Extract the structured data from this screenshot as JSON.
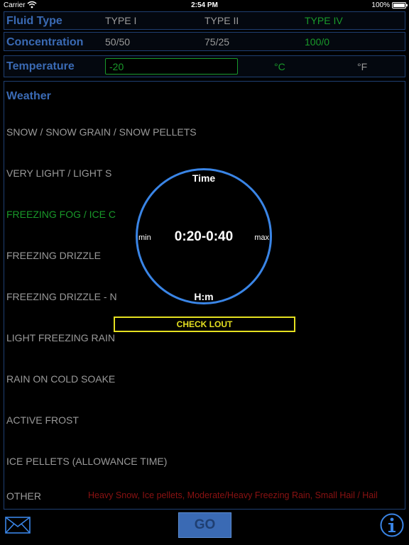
{
  "status_bar": {
    "carrier": "Carrier",
    "time": "2:54 PM",
    "battery": "100%",
    "battery_level": 1.0
  },
  "fluid_type": {
    "label": "Fluid Type",
    "options": [
      "TYPE I",
      "TYPE II",
      "TYPE IV"
    ],
    "selected": "TYPE IV"
  },
  "concentration": {
    "label": "Concentration",
    "options": [
      "50/50",
      "75/25",
      "100/0"
    ],
    "selected": "100/0"
  },
  "temperature": {
    "label": "Temperature",
    "value": "-20",
    "units": [
      "°C",
      "°F"
    ],
    "selected_unit": "°C"
  },
  "weather": {
    "label": "Weather",
    "items": [
      "SNOW / SNOW GRAIN / SNOW PELLETS",
      "VERY LIGHT / LIGHT S",
      "FREEZING FOG / ICE C",
      "FREEZING DRIZZLE",
      "FREEZING DRIZZLE - N",
      "LIGHT FREEZING RAIN",
      "RAIN ON COLD SOAKE",
      "ACTIVE FROST",
      "ICE PELLETS (ALLOWANCE TIME)",
      "OTHER"
    ],
    "selected": "FREEZING FOG / ICE C",
    "other_note": "Heavy Snow, Ice pellets, Moderate/Heavy Freezing Rain, Small Hail / Hail"
  },
  "result": {
    "title": "Time",
    "value": "0:20-0:40",
    "min_label": "min",
    "max_label": "max",
    "unit": "H:m"
  },
  "check_button": "CHECK LOUT",
  "go_button": "GO",
  "icons": {
    "mail": "mail-icon",
    "info": "info-icon",
    "wifi": "wifi-icon"
  },
  "colors": {
    "accent_blue": "#3a6ab4",
    "selected_green": "#19992a",
    "circle_blue": "#3a85e6",
    "warning_yellow": "#e5e020",
    "note_red": "#8b1212"
  }
}
